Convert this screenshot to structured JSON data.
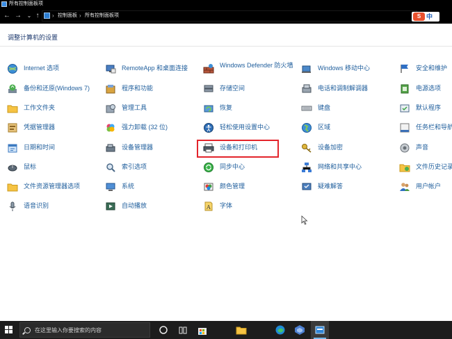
{
  "window": {
    "title": "所有控制面板项"
  },
  "addressbar": {
    "back_icon": "←",
    "forward_icon": "→",
    "recent_icon": "⌄",
    "up_icon": "↑",
    "sep_icon": "›",
    "breadcrumbs": [
      "控制面板",
      "所有控制面板项"
    ],
    "ime_logo": "S",
    "ime_lang": "中"
  },
  "main": {
    "heading": "调整计算机的设置",
    "columns": [
      [
        {
          "label": "Internet 选项",
          "icon": "globe-icon"
        },
        {
          "label": "备份和还原(Windows 7)",
          "icon": "backup-icon"
        },
        {
          "label": "工作文件夹",
          "icon": "folder-icon"
        },
        {
          "label": "凭据管理器",
          "icon": "credential-icon"
        },
        {
          "label": "日期和时间",
          "icon": "clock-icon"
        },
        {
          "label": "鼠标",
          "icon": "mouse-icon"
        },
        {
          "label": "文件资源管理器选项",
          "icon": "folder-icon"
        },
        {
          "label": "语音识别",
          "icon": "microphone-icon"
        }
      ],
      [
        {
          "label": "RemoteApp 和桌面连接",
          "icon": "remoteapp-icon"
        },
        {
          "label": "程序和功能",
          "icon": "programs-icon"
        },
        {
          "label": "管理工具",
          "icon": "admin-tools-icon"
        },
        {
          "label": "强力卸载 (32 位)",
          "icon": "uninstall-icon"
        },
        {
          "label": "设备管理器",
          "icon": "device-manager-icon"
        },
        {
          "label": "索引选项",
          "icon": "indexing-icon"
        },
        {
          "label": "系统",
          "icon": "system-icon"
        },
        {
          "label": "自动播放",
          "icon": "autoplay-icon"
        }
      ],
      [
        {
          "label": "Windows Defender 防火墙",
          "icon": "firewall-icon"
        },
        {
          "label": "存储空间",
          "icon": "storage-icon"
        },
        {
          "label": "恢复",
          "icon": "recovery-icon"
        },
        {
          "label": "轻松使用设置中心",
          "icon": "accessibility-icon"
        },
        {
          "label": "设备和打印机",
          "icon": "printer-icon"
        },
        {
          "label": "同步中心",
          "icon": "sync-icon"
        },
        {
          "label": "颜色管理",
          "icon": "color-icon"
        },
        {
          "label": "字体",
          "icon": "font-icon"
        }
      ],
      [
        {
          "label": "Windows 移动中心",
          "icon": "mobility-icon"
        },
        {
          "label": "电话和调制解调器",
          "icon": "phone-icon"
        },
        {
          "label": "键盘",
          "icon": "keyboard-icon"
        },
        {
          "label": "区域",
          "icon": "region-icon"
        },
        {
          "label": "设备加密",
          "icon": "encryption-icon"
        },
        {
          "label": "网络和共享中心",
          "icon": "network-icon"
        },
        {
          "label": "疑难解答",
          "icon": "troubleshoot-icon"
        }
      ],
      [
        {
          "label": "安全和维护",
          "icon": "flag-icon"
        },
        {
          "label": "电源选项",
          "icon": "power-icon"
        },
        {
          "label": "默认程序",
          "icon": "default-programs-icon"
        },
        {
          "label": "任务栏和导航",
          "icon": "taskbar-icon"
        },
        {
          "label": "声音",
          "icon": "speaker-icon"
        },
        {
          "label": "文件历史记录",
          "icon": "file-history-icon"
        },
        {
          "label": "用户帐户",
          "icon": "users-icon"
        }
      ]
    ]
  },
  "taskbar": {
    "search_placeholder": "在这里输入你要搜索的内容",
    "pinned": [
      "task-view-icon",
      "widgets-icon",
      "store-icon",
      "explorer-icon",
      "edge-icon",
      "app-icon",
      "control-panel-icon"
    ]
  },
  "colors": {
    "link": "#1f5e9c",
    "highlight": "#e3242b",
    "taskbar": "#1d1d1d"
  }
}
